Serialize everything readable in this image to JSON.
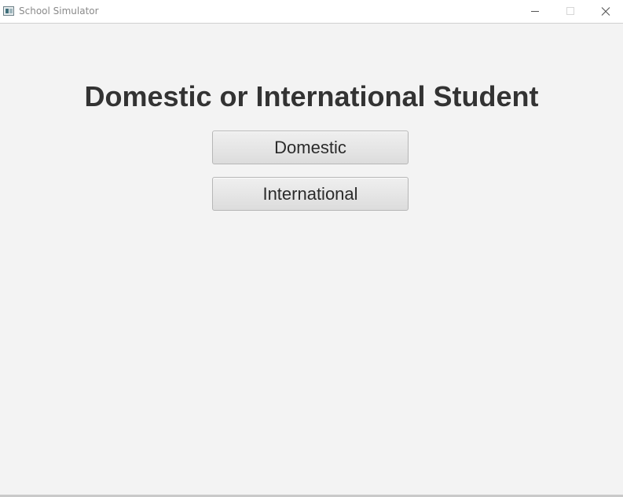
{
  "window": {
    "title": "School Simulator",
    "icon": "app-window-icon",
    "controls": {
      "minimize_icon": "minimize-icon",
      "maximize_icon": "maximize-icon",
      "close_icon": "close-icon"
    }
  },
  "main": {
    "heading": "Domestic or International Student",
    "buttons": {
      "domestic": "Domestic",
      "international": "International"
    }
  },
  "colors": {
    "background": "#f3f3f3",
    "heading_text": "#333333",
    "button_border": "#b6b6b6"
  }
}
